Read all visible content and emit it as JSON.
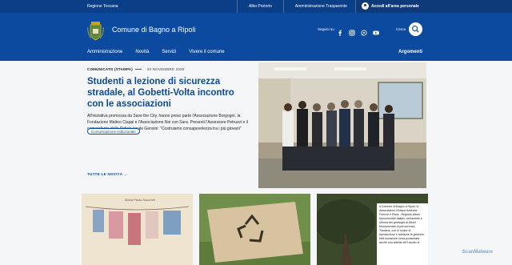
{
  "topbar": {
    "region": "Regione Toscana",
    "links": [
      "Albo Pretorio",
      "Amministrazione Trasparente"
    ],
    "login_label": "Accedi all'area personale"
  },
  "header": {
    "site_title": "Comune di Bagno a Ripoli",
    "social_label": "Seguici su",
    "search_label": "Cerca",
    "social_icons": [
      "facebook-icon",
      "instagram-icon",
      "whatsapp-icon",
      "youtube-icon"
    ],
    "nav": [
      "Amministrazione",
      "Novità",
      "Servizi",
      "Vivere il comune"
    ],
    "argomenti": "Argomenti"
  },
  "hero": {
    "kicker": "COMUNICATO (STAMPA)",
    "date": "20 NOVEMBRE 2025",
    "headline": "Studenti a lezione di sicurezza stradale, al Gobetti-Volta incontro con le associazioni",
    "summary": "All'iniziativa promossa da Save the City, hanno preso parte l'Associazione Borgognì, la Fondazione Matteo Ciappi e l'Associazione Noi con Sara. Presenti l'Assessore Petruzzi e il comandante della Polizia locale Gensini: \"Costruiamo consapevolezza tra i più giovani\"",
    "tag": "Comunicazione istituzionale",
    "read_all": "TUTTE LE NOVITÀ"
  },
  "cards": [
    {
      "caption": "Maria Paola Saccheri"
    },
    {
      "caption": ""
    },
    {
      "overlay": "Il Comune di Bagno a Ripoli, la Associazioni Unasud Address Firenze e Rami - Registro Alberi Monumentali Italiani, nell'ambito e dimora dei gestioghi di Alberi Monumentali di percorrenza Toscana, con lo scopo di riproduzione e tutelarne la gestione. Nell'occasione verrà presentata anche una tabella del Lascito di"
    }
  ],
  "watermark": "ScanMalware",
  "colors": {
    "brand_dark": "#0a3f87",
    "brand": "#0b4a9e",
    "page_bg": "#f5f6f7"
  }
}
